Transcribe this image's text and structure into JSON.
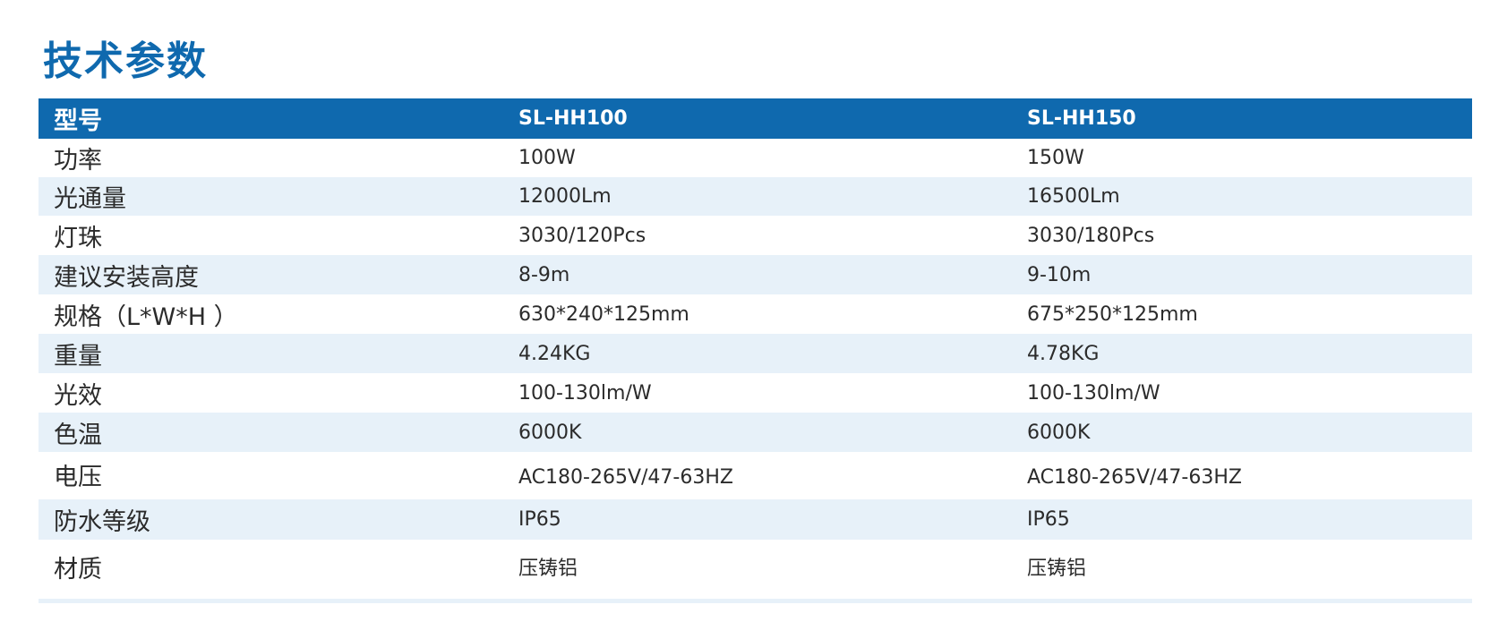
{
  "title": "技术参数",
  "table": {
    "header": [
      "型号",
      "SL-HH100",
      "SL-HH150"
    ],
    "rows": [
      [
        "功率",
        "100W",
        "150W"
      ],
      [
        "光通量",
        "12000Lm",
        "16500Lm"
      ],
      [
        "灯珠",
        "3030/120Pcs",
        "3030/180Pcs"
      ],
      [
        "建议安装高度",
        "8-9m",
        "9-10m"
      ],
      [
        "规格（L*W*H ）",
        "630*240*125mm",
        "675*250*125mm"
      ],
      [
        "重量",
        "4.24KG",
        "4.78KG"
      ],
      [
        "光效",
        "100-130lm/W",
        "100-130lm/W"
      ],
      [
        "色温",
        "6000K",
        "6000K"
      ],
      [
        "电压",
        "AC180-265V/47-63HZ",
        "AC180-265V/47-63HZ"
      ],
      [
        "防水等级",
        "IP65",
        "IP65"
      ],
      [
        "材质",
        "压铸铝",
        "压铸铝"
      ]
    ]
  },
  "colors": {
    "accent": "#0f69ae",
    "stripe": "#e7f1f9",
    "text": "#2b2b2b"
  }
}
